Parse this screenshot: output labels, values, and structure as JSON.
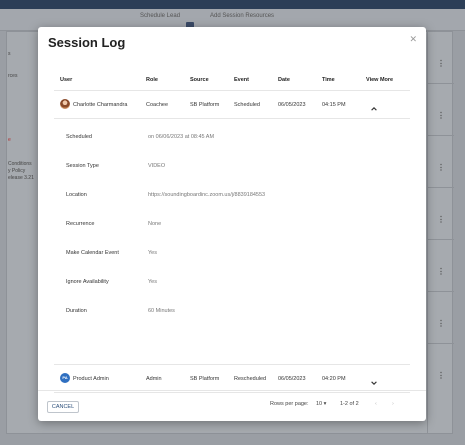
{
  "background": {
    "toolbar_items": [
      "Schedule Lead",
      "Add Session Resources"
    ],
    "left_snippets": [
      "s",
      "rces",
      "e",
      "Conditions",
      "y Policy",
      "elease 3.21"
    ]
  },
  "modal": {
    "title": "Session Log",
    "close_icon": "close-icon"
  },
  "table": {
    "headers": {
      "user": "User",
      "role": "Role",
      "source": "Source",
      "event": "Event",
      "date": "Date",
      "time": "Time",
      "more": "View More"
    },
    "rows": [
      {
        "user": "Charlotte Charmandra",
        "role": "Coachee",
        "source": "SB Platform",
        "event": "Scheduled",
        "date": "06/05/2023",
        "time": "04:15 PM",
        "expanded": true,
        "avatar": "photo"
      },
      {
        "user": "Product Admin",
        "initials": "PA",
        "role": "Admin",
        "source": "SB Platform",
        "event": "Rescheduled",
        "date": "06/05/2023",
        "time": "04:20 PM",
        "expanded": false,
        "avatar": "initials"
      }
    ],
    "details": [
      {
        "label": "Scheduled",
        "value": "on 06/06/2023 at 08:45 AM"
      },
      {
        "label": "Session Type",
        "value": "VIDEO"
      },
      {
        "label": "Location",
        "value": "https://soundingboardinc.zoom.us/j/8839184553"
      },
      {
        "label": "Recurrence",
        "value": "None"
      },
      {
        "label": "Make Calendar Event",
        "value": "Yes"
      },
      {
        "label": "Ignore Availability",
        "value": "Yes"
      },
      {
        "label": "Duration",
        "value": "60 Minutes"
      }
    ]
  },
  "pagination": {
    "rows_per_page_label": "Rows per page:",
    "rows_per_page_value": "10",
    "range": "1-2 of 2"
  },
  "footer": {
    "cancel_label": "CANCEL"
  }
}
